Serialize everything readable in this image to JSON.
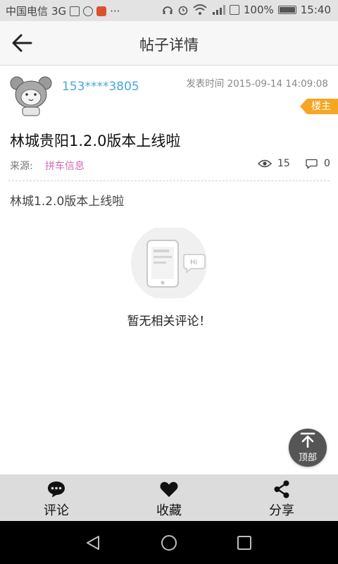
{
  "status_bar": {
    "carrier": "中国电信",
    "network": "3G",
    "battery": "100%",
    "time": "15:40",
    "icons": [
      "image-icon",
      "signal-loop-icon",
      "app-icon",
      "more-dots-icon",
      "headphones-icon",
      "alarm-icon",
      "wifi-icon",
      "cell-signal-icon",
      "sim-icon",
      "battery-icon"
    ]
  },
  "header": {
    "title": "帖子详情",
    "back_icon": "arrow-left-icon"
  },
  "post": {
    "username": "153****3805",
    "time_label": "发表时间",
    "time_value": "2015-09-14 14:09:08",
    "badge": "楼主",
    "title": "林城贵阳1.2.0版本上线啦",
    "source_label": "来源:",
    "source_value": "拼车信息",
    "views": "15",
    "comments": "0",
    "content": "林城1.2.0版本上线啦"
  },
  "empty_state": {
    "text": "暂无相关评论！"
  },
  "top_button": {
    "label": "顶部"
  },
  "actions": [
    {
      "label": "评论",
      "icon": "comment-bubble-icon"
    },
    {
      "label": "收藏",
      "icon": "heart-icon"
    },
    {
      "label": "分享",
      "icon": "share-icon"
    }
  ],
  "colors": {
    "username": "#4aa8d8",
    "source": "#d26ab6",
    "badge": "#f5a623",
    "action_bar": "#dcdcdc"
  }
}
